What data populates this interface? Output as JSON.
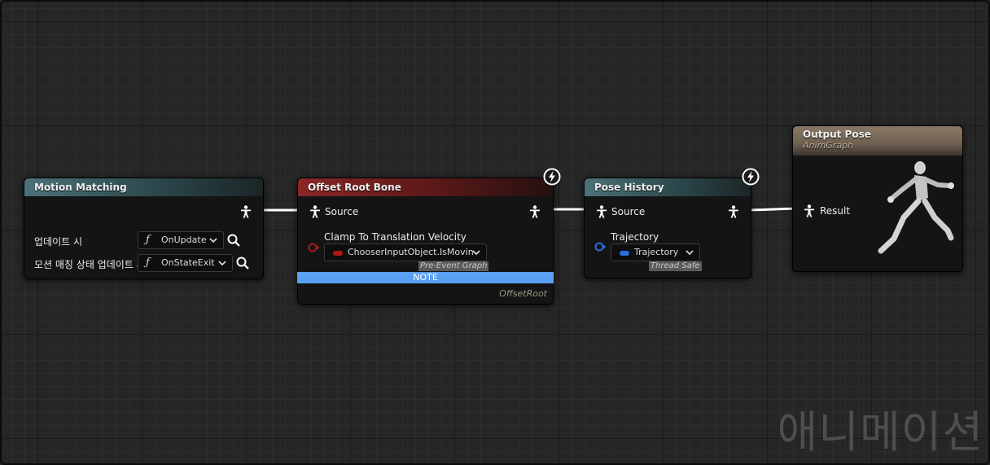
{
  "nodes": {
    "motion_matching": {
      "title": "Motion Matching",
      "rows": [
        {
          "label": "업데이트 시",
          "function": "OnUpdate"
        },
        {
          "label": "모션 매칭 상태 업데이트 시",
          "function": "OnStateExit"
        }
      ]
    },
    "offset_root_bone": {
      "title": "Offset Root Bone",
      "source_label": "Source",
      "clamp_label": "Clamp To Translation Velocity",
      "clamp_value": "ChooserInputObject.IsMovin",
      "clamp_tag": "Pre-Event Graph",
      "note_label": "NOTE",
      "footer": "OffsetRoot"
    },
    "pose_history": {
      "title": "Pose History",
      "source_label": "Source",
      "trajectory_label": "Trajectory",
      "trajectory_value": "Trajectory",
      "trajectory_tag": "Thread Safe"
    },
    "output_pose": {
      "title": "Output Pose",
      "subtitle": "AnimGraph",
      "result_label": "Result"
    }
  },
  "watermark": "애니메이션",
  "colors": {
    "wire": "#ffffff",
    "red_pin": "#b01818",
    "blue_pin": "#2a6ee0",
    "note": "#5aa0f2"
  },
  "icons": {
    "pose_pin": "person-icon",
    "fast_path": "lightning-icon",
    "search": "magnifier-icon"
  }
}
